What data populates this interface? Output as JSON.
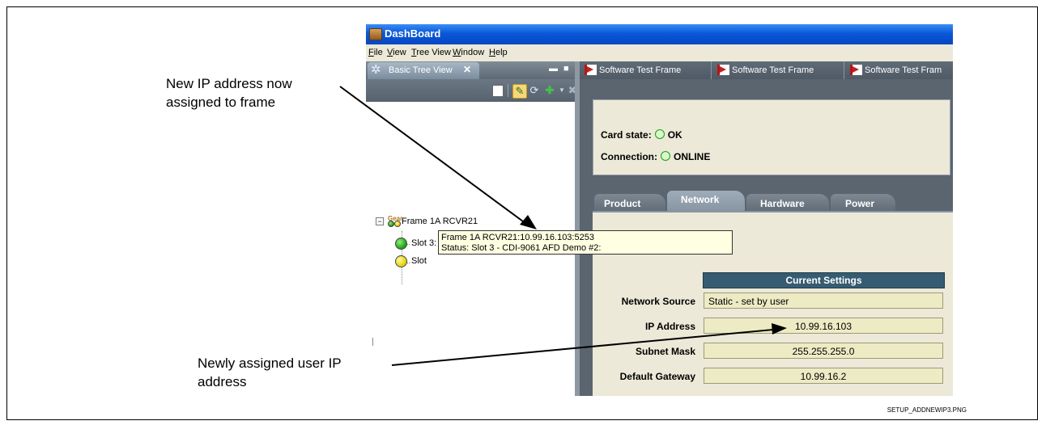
{
  "annotations": {
    "top_callout": [
      "New IP address now",
      "assigned to frame"
    ],
    "bottom_callout": [
      "Newly assigned user IP",
      "address"
    ],
    "filename": "SETUP_ADDNEWIP3.PNG"
  },
  "window": {
    "title": "DashBoard",
    "menu": [
      "File",
      "View",
      "Tree View",
      "Window",
      "Help"
    ]
  },
  "tree_view": {
    "tab_label": "Basic Tree View",
    "tab_close": "✕",
    "frame_label": "Frame 1A RCVR21",
    "frame_icon_text": "Gear",
    "slots": [
      {
        "label": "Slot 3: AFD Demo #2",
        "status_color": "green"
      },
      {
        "label": "Slot",
        "status_color": "yellow"
      }
    ],
    "tooltip": [
      "Frame 1A RCVR21:10.99.16.103:5253",
      "Status: Slot 3 - CDI-9061  AFD Demo #2:"
    ]
  },
  "doc_tabs": [
    "Software Test Frame",
    "Software Test Frame",
    "Software Test Fram"
  ],
  "status": {
    "card_state_label": "Card state:",
    "card_state_value": "OK",
    "connection_label": "Connection:",
    "connection_value": "ONLINE"
  },
  "card_tabs": [
    "Product",
    "Network",
    "Hardware",
    "Power"
  ],
  "active_card_tab": "Network",
  "network": {
    "header": "Current Settings",
    "rows": [
      {
        "label": "Network Source",
        "value": "Static - set by user"
      },
      {
        "label": "IP Address",
        "value": "10.99.16.103"
      },
      {
        "label": "Subnet Mask",
        "value": "255.255.255.0"
      },
      {
        "label": "Default Gateway",
        "value": "10.99.16.2"
      }
    ]
  },
  "colors": {
    "titlebar": "#0a58d8",
    "current_settings_header": "#365c72",
    "field_background": "#ecebc4",
    "tooltip_background": "#ffffe1"
  }
}
